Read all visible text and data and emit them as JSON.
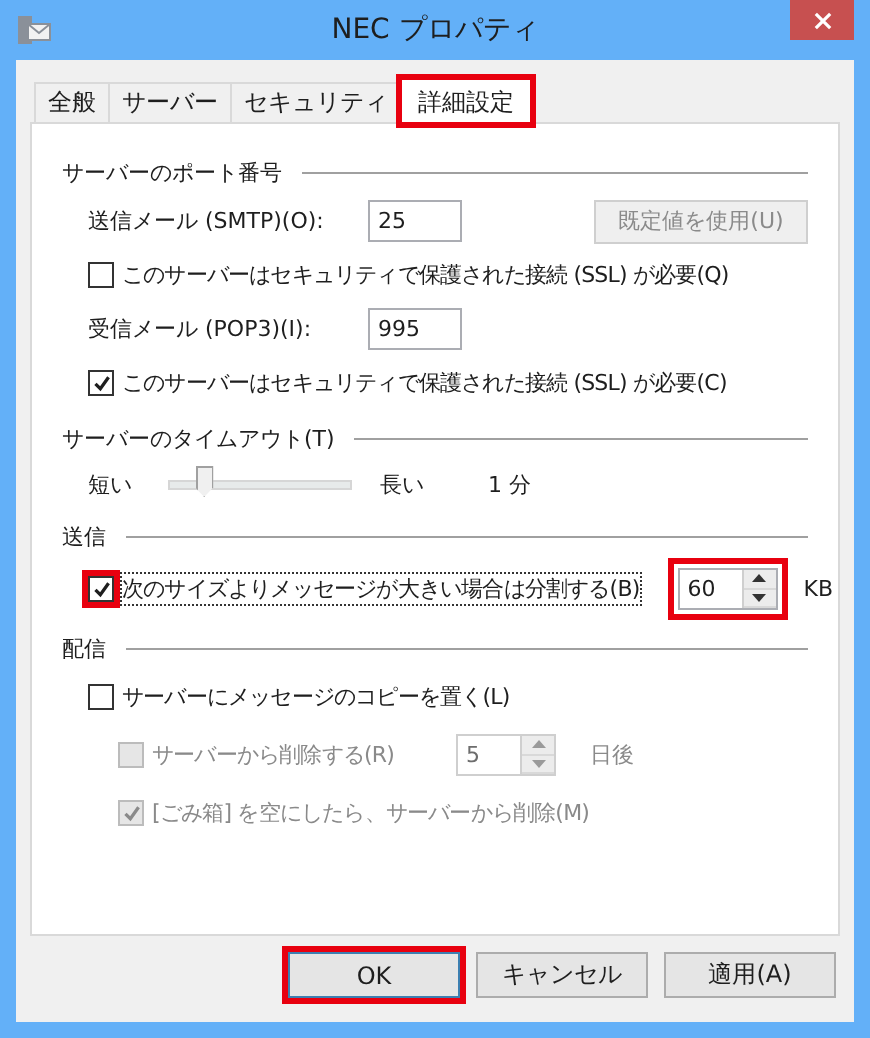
{
  "window": {
    "title": "NEC プロパティ"
  },
  "tabs": [
    {
      "label": "全般",
      "selected": false,
      "highlighted": false
    },
    {
      "label": "サーバー",
      "selected": false,
      "highlighted": false
    },
    {
      "label": "セキュリティ",
      "selected": false,
      "highlighted": false
    },
    {
      "label": "詳細設定",
      "selected": true,
      "highlighted": true
    }
  ],
  "port_section": {
    "title": "サーバーのポート番号",
    "smtp": {
      "label": "送信メール (SMTP)(O):",
      "value": "25"
    },
    "default_button": {
      "label": "既定値を使用(U)",
      "disabled": true
    },
    "smtp_ssl": {
      "label": "このサーバーはセキュリティで保護された接続 (SSL) が必要(Q)",
      "checked": false
    },
    "pop3": {
      "label": "受信メール (POP3)(I):",
      "value": "995"
    },
    "pop3_ssl": {
      "label": "このサーバーはセキュリティで保護された接続 (SSL) が必要(C)",
      "checked": true
    }
  },
  "timeout_section": {
    "title": "サーバーのタイムアウト(T)",
    "min_label": "短い",
    "max_label": "長い",
    "level": 0.14,
    "reading": "1 分"
  },
  "send_section": {
    "title": "送信",
    "split": {
      "label": "次のサイズよりメッセージが大きい場合は分割する(B)",
      "checked": true,
      "highlighted": true
    },
    "size": {
      "value": "60",
      "highlighted": true
    },
    "unit": "KB"
  },
  "delivery_section": {
    "title": "配信",
    "leave_copy": {
      "label": "サーバーにメッセージのコピーを置く(L)",
      "checked": false,
      "disabled": false
    },
    "delete_after": {
      "label": "サーバーから削除する(R)",
      "checked": false,
      "disabled": true
    },
    "days": {
      "value": "5",
      "disabled": true
    },
    "days_unit": "日後",
    "delete_on_empty": {
      "label": "[ごみ箱] を空にしたら、サーバーから削除(M)",
      "checked": true,
      "disabled": true
    }
  },
  "buttons": [
    {
      "label": "OK",
      "highlighted": true
    },
    {
      "label": "キャンセル",
      "highlighted": false
    },
    {
      "label": "適用(A)",
      "highlighted": false
    }
  ]
}
